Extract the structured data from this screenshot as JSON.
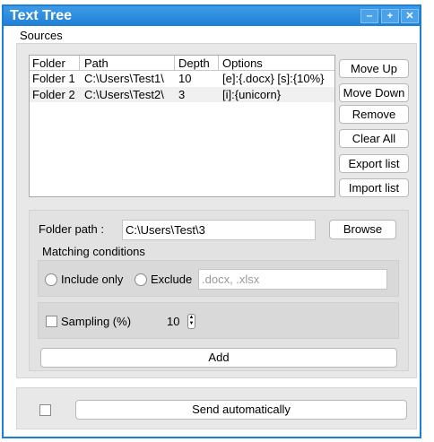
{
  "window": {
    "title": "Text Tree",
    "controls": {
      "minimize": "‒",
      "maximize": "+",
      "close": "✕"
    }
  },
  "menu": {
    "sources": "Sources"
  },
  "table": {
    "columns": [
      "Folder",
      "Path",
      "Depth",
      "Options"
    ],
    "rows": [
      [
        "Folder 1",
        "C:\\Users\\Test1\\",
        "10",
        "[e]:{.docx} [s]:{10%}"
      ],
      [
        "Folder 2",
        "C:\\Users\\Test2\\",
        "3",
        "[i]:{unicorn}"
      ]
    ]
  },
  "side_buttons": {
    "move_up": "Move Up",
    "move_down": "Move Down",
    "remove": "Remove",
    "clear_all": "Clear All",
    "export_list": "Export list",
    "import_list": "Import list"
  },
  "folder": {
    "path_label": "Folder path :",
    "path_value": "C:\\Users\\Test\\3",
    "browse": "Browse"
  },
  "matching": {
    "title": "Matching conditions",
    "include_only": "Include only",
    "exclude": "Exclude",
    "extensions_placeholder": ".docx, .xlsx"
  },
  "sampling": {
    "label": "Sampling (%)",
    "value": "10"
  },
  "add_button": "Add",
  "send_automatically": "Send automatically"
}
